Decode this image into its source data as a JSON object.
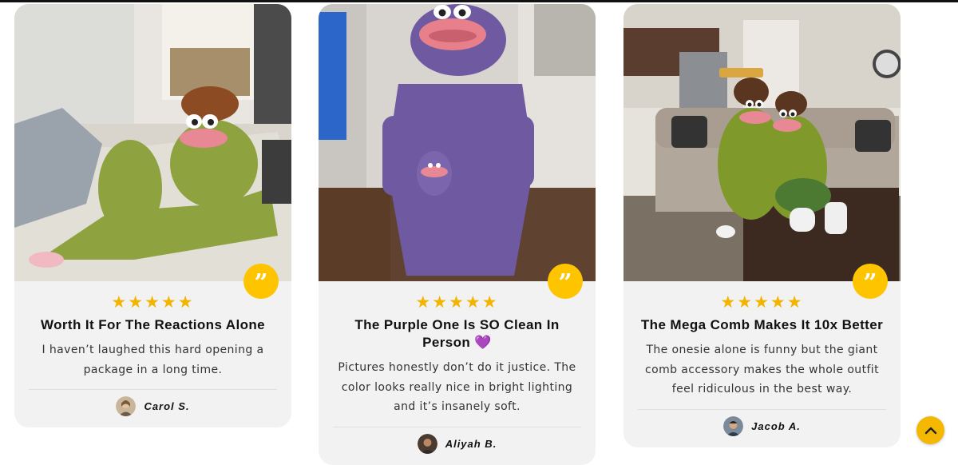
{
  "colors": {
    "accent": "#ffc400",
    "star": "#f3b400",
    "heart": "#7b4fd6"
  },
  "reviews": [
    {
      "stars": "★★★★★",
      "title": "Worth It For The Reactions Alone",
      "text": "I haven’t laughed this hard opening a package in a long time.",
      "author": "Carol S.",
      "photo": "green frog onesie on couch"
    },
    {
      "stars": "★★★★★",
      "title": "The Purple One Is SO Clean In Person",
      "title_emoji": "💜",
      "text": "Pictures honestly don’t do it justice. The color looks really nice in bright lighting and it’s insanely soft.",
      "author": "Aliyah B.",
      "photo": "purple frog onesie standing"
    },
    {
      "stars": "★★★★★",
      "title": "The Mega Comb Makes It 10x Better",
      "text": "The onesie alone is funny but the giant comb accessory makes the whole outfit feel ridiculous in the best way.",
      "author": "Jacob A.",
      "photo": "two green frog onesies on sofa"
    }
  ],
  "quote_icon": "”",
  "scroll_top_icon": "chevron-up-icon"
}
